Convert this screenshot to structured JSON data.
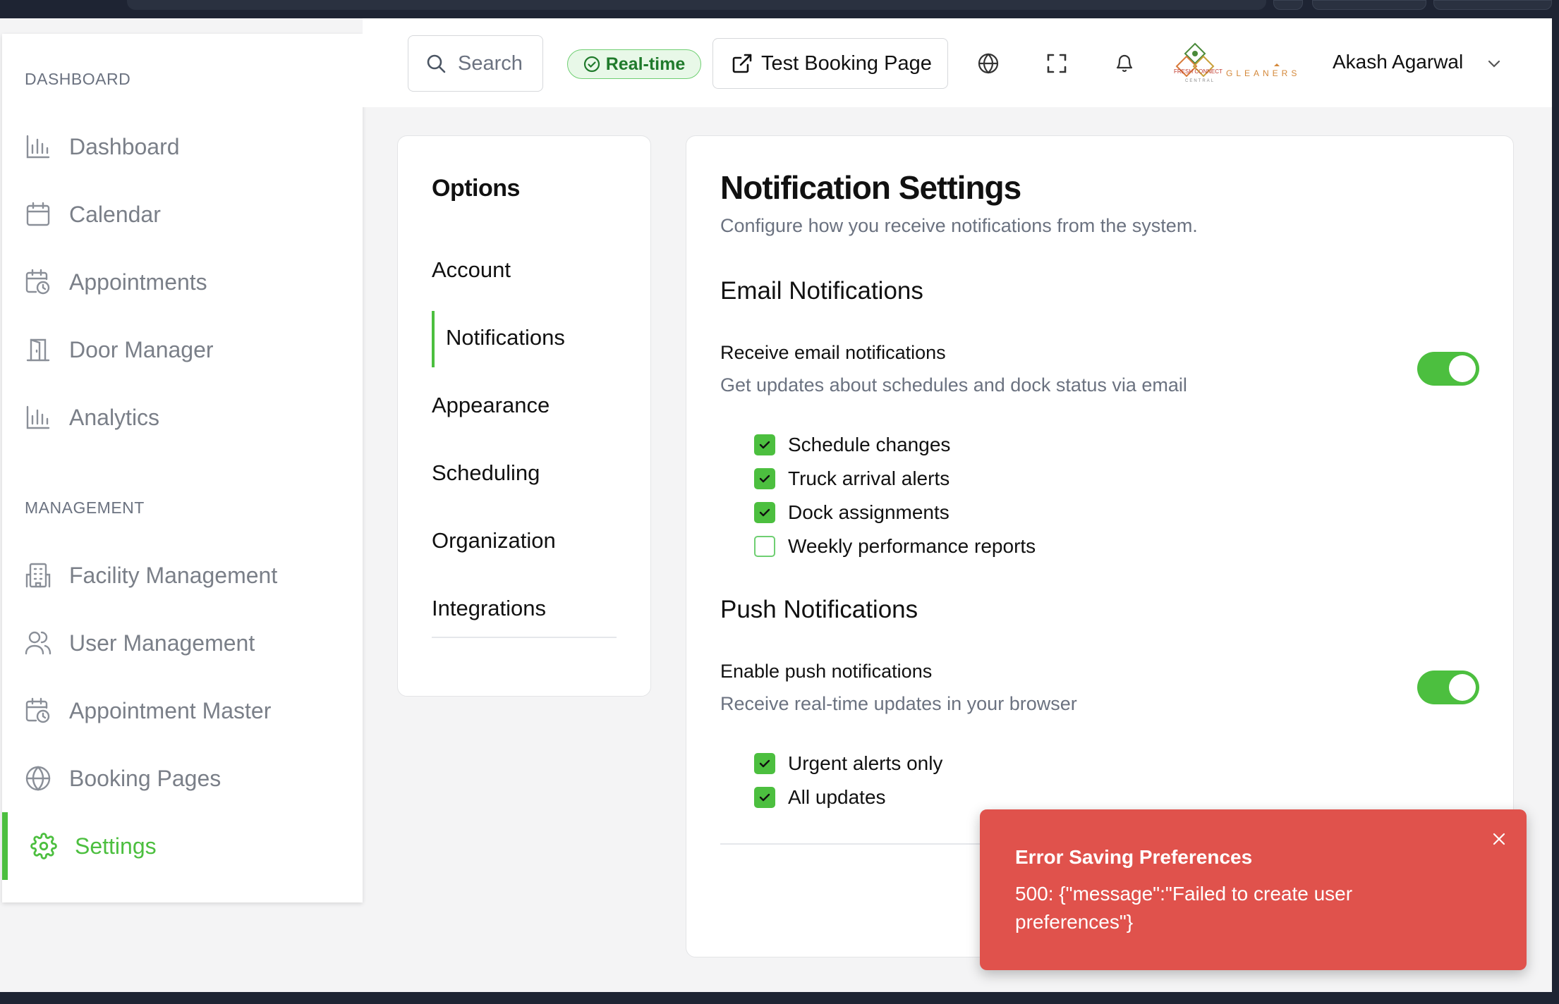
{
  "sidebar": {
    "section_dashboard": "DASHBOARD",
    "section_management": "MANAGEMENT",
    "items": [
      {
        "label": "Dashboard",
        "icon": "bar-chart-icon"
      },
      {
        "label": "Calendar",
        "icon": "calendar-icon"
      },
      {
        "label": "Appointments",
        "icon": "calendar-clock-icon"
      },
      {
        "label": "Door Manager",
        "icon": "door-icon"
      },
      {
        "label": "Analytics",
        "icon": "bar-chart-icon"
      },
      {
        "label": "Facility Management",
        "icon": "building-icon"
      },
      {
        "label": "User Management",
        "icon": "users-icon"
      },
      {
        "label": "Appointment Master",
        "icon": "calendar-clock-icon"
      },
      {
        "label": "Booking Pages",
        "icon": "globe-icon"
      },
      {
        "label": "Settings",
        "icon": "gear-icon",
        "active": true
      }
    ]
  },
  "header": {
    "search_label": "Search",
    "realtime_label": "Real-time",
    "test_booking_label": "Test Booking Page",
    "logo_text": "FRESH CONNECT CENTRAL GLEANERS",
    "user_name": "Akash Agarwal"
  },
  "options": {
    "title": "Options",
    "items": [
      "Account",
      "Notifications",
      "Appearance",
      "Scheduling",
      "Organization",
      "Integrations"
    ],
    "active": "Notifications"
  },
  "main": {
    "title": "Notification Settings",
    "subtitle": "Configure how you receive notifications from the system.",
    "email": {
      "section_title": "Email Notifications",
      "toggle_title": "Receive email notifications",
      "toggle_sub": "Get updates about schedules and dock status via email",
      "toggle_on": true,
      "checkboxes": [
        {
          "label": "Schedule changes",
          "checked": true
        },
        {
          "label": "Truck arrival alerts",
          "checked": true
        },
        {
          "label": "Dock assignments",
          "checked": true
        },
        {
          "label": "Weekly performance reports",
          "checked": false
        }
      ]
    },
    "push": {
      "section_title": "Push Notifications",
      "toggle_title": "Enable push notifications",
      "toggle_sub": "Receive real-time updates in your browser",
      "toggle_on": true,
      "checkboxes": [
        {
          "label": "Urgent alerts only",
          "checked": true
        },
        {
          "label": "All updates",
          "checked": true
        }
      ]
    }
  },
  "toast": {
    "title": "Error Saving Preferences",
    "message": "500: {\"message\":\"Failed to create user preferences\"}"
  },
  "colors": {
    "accent": "#4cbf3f",
    "toast_bg": "#e0524c",
    "muted_text": "#6b7280"
  }
}
